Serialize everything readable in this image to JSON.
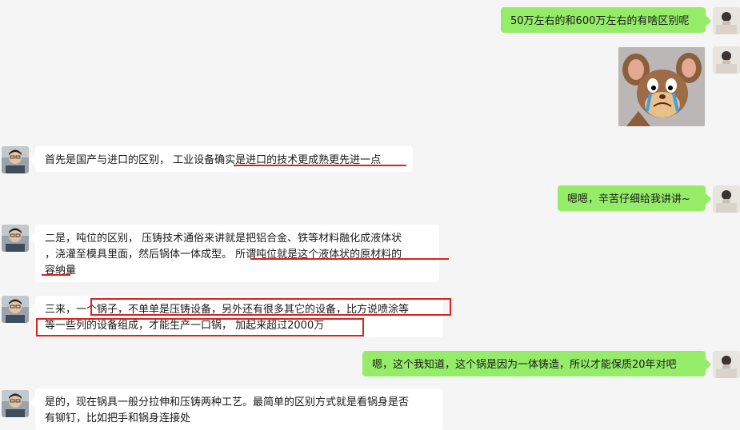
{
  "messages": [
    {
      "side": "right",
      "text": "50万左右的和600万左右的有啥区别呢"
    },
    {
      "side": "left",
      "lines": [
        "首先是国产与进口的区别， 工业设备确实是进口的技术更成熟更先进一点"
      ]
    },
    {
      "side": "right",
      "text": "嗯嗯，辛苦仔细给我讲讲~"
    },
    {
      "side": "left",
      "lines": [
        "二是，吨位的区别， 压铸技术通俗来讲就是把铝合金、铁等材料融化成液体状",
        "，浇灌至模具里面，然后锅体一体成型。 所谓吨位就是这个液体状的原材料的",
        "容纳量"
      ]
    },
    {
      "side": "left",
      "lines": [
        "三来，一个锅子，不单单是压铸设备，另外还有很多其它的设备，比方说喷涂等",
        "等一些列的设备组成，才能生产一口锅， 加起来超过2000万"
      ]
    },
    {
      "side": "right",
      "text": "嗯，这个我知道，这个锅是因为一体铸造，所以才能保质20年对吧"
    },
    {
      "side": "left",
      "lines": [
        "是的，现在锅具一般分拉伸和压铸两种工艺。最简单的区别方式就是看锅身是否",
        "有铆钉，比如把手和锅身连接处"
      ]
    }
  ],
  "sticker": {
    "name": "crying-mouse-sticker"
  },
  "colors": {
    "bubble_right": "#95ec69",
    "bubble_left": "#ffffff",
    "background": "#f5f5f5",
    "highlight": "#e02020"
  }
}
